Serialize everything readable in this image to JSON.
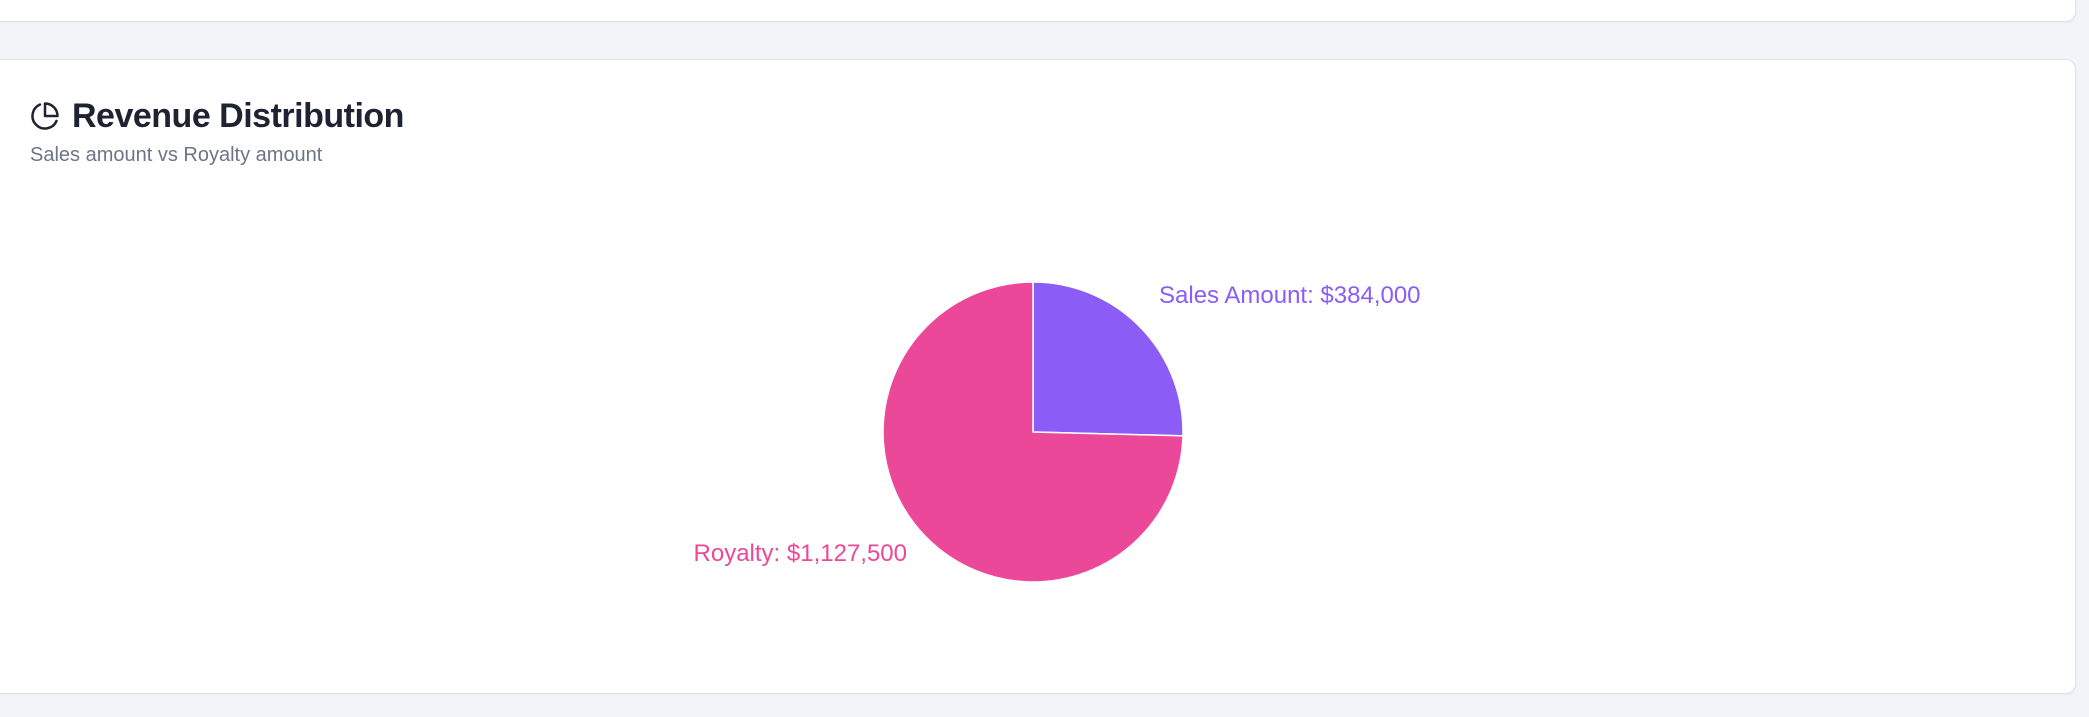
{
  "header": {
    "title": "Revenue Distribution",
    "subtitle": "Sales amount vs Royalty amount",
    "icon": "pie-chart-icon"
  },
  "chart_data": {
    "type": "pie",
    "title": "Revenue Distribution",
    "subtitle": "Sales amount vs Royalty amount",
    "slices": [
      {
        "name": "Sales Amount",
        "value": 384000,
        "label": "Sales Amount: $384,000",
        "color": "#8b5cf6"
      },
      {
        "name": "Royalty",
        "value": 1127500,
        "label": "Royalty: $1,127,500",
        "color": "#ec4899"
      }
    ],
    "start_angle": "12 o'clock",
    "direction": "clockwise",
    "legend": "none",
    "data_labels": "outside"
  },
  "colors": {
    "background": "#f1f4f8",
    "card": "#ffffff",
    "sales": "#8b5cf6",
    "royalty": "#ec4899"
  }
}
